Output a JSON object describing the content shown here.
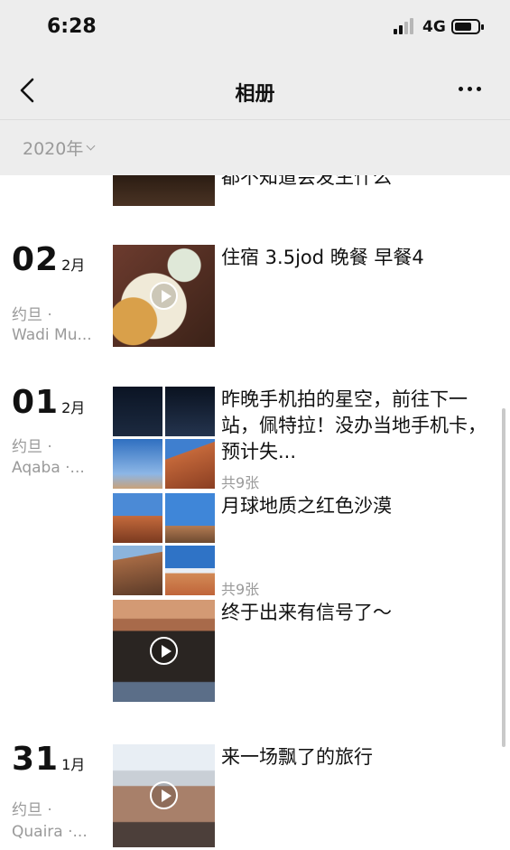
{
  "status": {
    "time": "6:28",
    "network": "4G"
  },
  "nav": {
    "title": "相册",
    "back_icon": "chevron-left-icon",
    "more_icon": "more-dots-icon"
  },
  "filter": {
    "year": "2020年"
  },
  "partial_entry": {
    "caption": "都不知道会发生什么"
  },
  "entries": [
    {
      "day": "02",
      "month": "2月",
      "loc_line1": "约旦 ·",
      "loc_line2": "Wadi Mu...",
      "posts": [
        {
          "type": "video",
          "caption": "住宿 3.5jod 晚餐 早餐4"
        }
      ]
    },
    {
      "day": "01",
      "month": "2月",
      "loc_line1": "约旦 ·",
      "loc_line2": "Aqaba ·...",
      "posts": [
        {
          "type": "album",
          "caption": "昨晚手机拍的星空，前往下一站，佩特拉！没办当地手机卡，预计失...",
          "count": "共9张"
        },
        {
          "type": "album",
          "caption": "月球地质之红色沙漠",
          "count": "共9张"
        },
        {
          "type": "video",
          "caption": "终于出来有信号了～"
        }
      ]
    },
    {
      "day": "31",
      "month": "1月",
      "loc_line1": "约旦 ·",
      "loc_line2": "Quaira ·...",
      "posts": [
        {
          "type": "video",
          "caption": "来一场飘了的旅行"
        }
      ]
    }
  ]
}
